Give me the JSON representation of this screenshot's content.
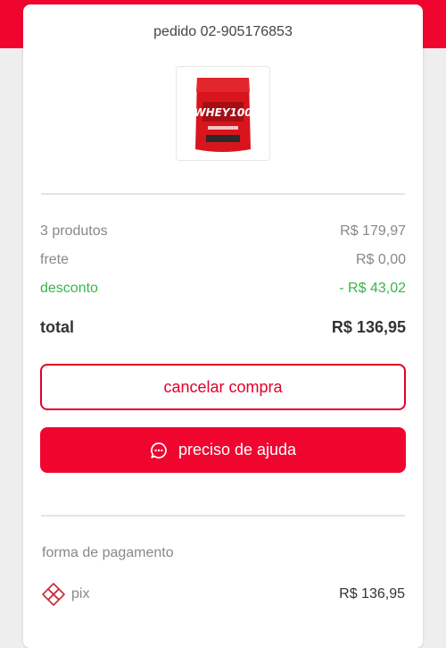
{
  "order": {
    "title": "pedido 02-905176853"
  },
  "product": {
    "image_name": "whey-protein-bag",
    "brand_text": "WHEY100"
  },
  "summary": {
    "products": {
      "label": "3 produtos",
      "value": "R$ 179,97"
    },
    "shipping": {
      "label": "frete",
      "value": "R$ 0,00"
    },
    "discount": {
      "label": "desconto",
      "value": "- R$ 43,02"
    },
    "total": {
      "label": "total",
      "value": "R$ 136,95"
    }
  },
  "actions": {
    "cancel_label": "cancelar compra",
    "help_label": "preciso de ajuda",
    "help_icon": "chat-bubble-icon"
  },
  "payment": {
    "section_label": "forma de pagamento",
    "method": "pix",
    "method_icon": "pix-icon",
    "amount": "R$ 136,95"
  },
  "colors": {
    "brand_red": "#f0052f",
    "discount_green": "#39b54a",
    "pix_icon": "#c22d3a"
  }
}
